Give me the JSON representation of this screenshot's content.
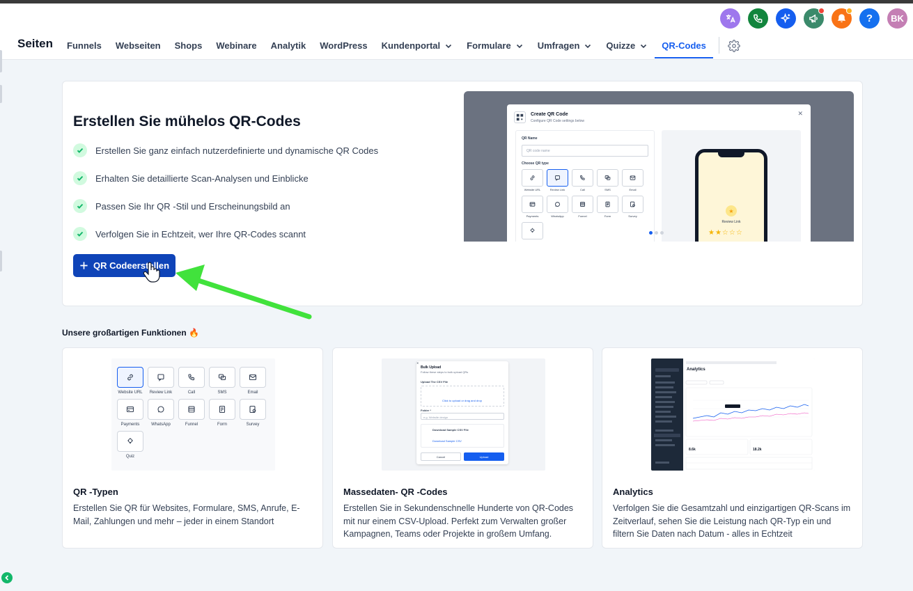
{
  "top_icons": [
    {
      "name": "translate-icon",
      "color": "#9e77ed"
    },
    {
      "name": "phone-icon",
      "color": "#12853d"
    },
    {
      "name": "sparkle-icon",
      "color": "#155eef"
    },
    {
      "name": "megaphone-icon",
      "color": "#3b8a6b"
    },
    {
      "name": "bell-icon",
      "color": "#f97316"
    },
    {
      "name": "help-icon",
      "color": "#1570ef"
    }
  ],
  "user": {
    "initials": "BK",
    "color": "#c47fb4"
  },
  "nav": {
    "title": "Seiten",
    "items": [
      {
        "label": "Funnels"
      },
      {
        "label": "Webseiten"
      },
      {
        "label": "Shops"
      },
      {
        "label": "Webinare"
      },
      {
        "label": "Analytik"
      },
      {
        "label": "WordPress"
      },
      {
        "label": "Kundenportal",
        "dropdown": true
      },
      {
        "label": "Formulare",
        "dropdown": true
      },
      {
        "label": "Umfragen",
        "dropdown": true
      },
      {
        "label": "Quizze",
        "dropdown": true
      },
      {
        "label": "QR-Codes",
        "active": true
      }
    ]
  },
  "hero": {
    "title": "Erstellen Sie mühelos QR-Codes",
    "features": [
      "Erstellen Sie ganz einfach nutzerdefinierte und dynamische QR Codes",
      "Erhalten Sie detaillierte Scan-Analysen und Einblicke",
      "Passen Sie Ihr QR -Stil und Erscheinungsbild an",
      "Verfolgen Sie in Echtzeit, wer Ihre QR-Codes scannt"
    ],
    "cta_label": "QR Codeerstellen",
    "preview": {
      "modal_title": "Create QR Code",
      "modal_subtitle": "Configure QR Code settings below",
      "qr_name_label": "QR Name",
      "qr_name_placeholder": "QR code name",
      "choose_type_label": "Choose QR type",
      "types": [
        "Website URL",
        "Review Link",
        "Call",
        "SMS",
        "Email",
        "Payments",
        "WhatsApp",
        "Funnel",
        "Form",
        "Survey",
        ""
      ],
      "phone_label": "Review Link"
    }
  },
  "features_section": {
    "title": "Unsere großartigen Funktionen 🔥",
    "cards": [
      {
        "title": "QR -Typen",
        "desc": "Erstellen Sie QR für Websites, Formulare, SMS, Anrufe, E-Mail, Zahlungen und mehr – jeder in einem Standort",
        "types": [
          "Website URL",
          "Review Link",
          "Call",
          "SMS",
          "Email",
          "Payments",
          "WhatsApp",
          "Funnel",
          "Form",
          "Survey",
          "Quiz"
        ]
      },
      {
        "title": "Massedaten- QR -Codes",
        "desc": "Erstellen Sie in Sekundenschnelle Hunderte von QR-Codes mit nur einem CSV-Upload. Perfekt zum Verwalten großer Kampagnen, Teams oder Projekte in großem Umfang.",
        "bulk": {
          "title": "Bulk Upload",
          "subtitle": "Follow these steps to bulk upload QRs",
          "upload_label": "Upload The CSV File",
          "drop_text": "Click to upload or drag and drop",
          "folder_label": "Folder *",
          "folder_placeholder": "e.g. Website design",
          "sample_title": "Download Sample CSV File",
          "sample_link": "Download Sample CSV",
          "cancel": "Cancel",
          "upload": "Upload"
        }
      },
      {
        "title": "Analytics",
        "desc": "Verfolgen Sie die Gesamtzahl und einzigartigen QR-Scans im Zeitverlauf, sehen Sie die Leistung nach QR-Typ ein und filtern Sie Daten nach Datum - alles in Echtzeit",
        "mock": {
          "heading": "Analytics",
          "stat1": "8.6k",
          "stat2": "18.2k"
        }
      }
    ]
  }
}
